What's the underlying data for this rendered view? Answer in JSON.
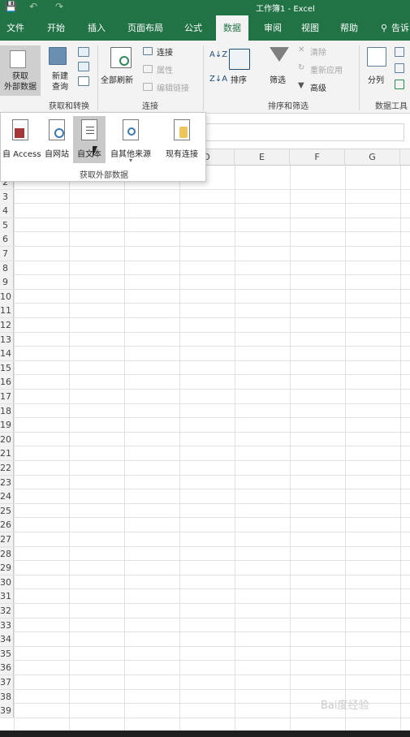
{
  "title_bar": {
    "title": "工作簿1  -  Excel",
    "save_icon": "save-icon",
    "undo_icon": "undo-icon",
    "redo_icon": "redo-icon"
  },
  "tabs": [
    {
      "label": "文件"
    },
    {
      "label": "开始"
    },
    {
      "label": "插入"
    },
    {
      "label": "页面布局"
    },
    {
      "label": "公式"
    },
    {
      "label": "数据",
      "active": true
    },
    {
      "label": "审阅"
    },
    {
      "label": "视图"
    },
    {
      "label": "帮助"
    },
    {
      "label": "告诉"
    }
  ],
  "ribbon": {
    "get_external": "获取\n外部数据",
    "new_query": "新建\n查询",
    "refresh_all": "全部刷新",
    "connections": "连接",
    "properties": "属性",
    "edit_links": "编辑链接",
    "sort": "排序",
    "filter": "筛选",
    "clear": "清除",
    "reapply": "重新应用",
    "advanced": "高级",
    "text_to_columns": "分列",
    "group_get_transform": "获取和转换",
    "group_connections": "连接",
    "group_sort_filter": "排序和筛选",
    "group_data_tools": "数据工具"
  },
  "dropdown": {
    "items": [
      {
        "label": "自 Access",
        "icon": "access-icon"
      },
      {
        "label": "自网站",
        "icon": "web-icon"
      },
      {
        "label": "自文本",
        "icon": "text-file-icon",
        "hover": true
      },
      {
        "label": "自其他来源",
        "icon": "other-sources-icon"
      },
      {
        "label": "现有连接",
        "icon": "existing-connections-icon"
      }
    ],
    "group_label": "获取外部数据"
  },
  "columns": [
    "D",
    "E",
    "F",
    "G"
  ],
  "rows": [
    "2",
    "3",
    "4",
    "5",
    "6",
    "7",
    "8",
    "9",
    "10",
    "11",
    "12",
    "13",
    "14",
    "15",
    "16",
    "17",
    "18",
    "19",
    "20",
    "21",
    "22",
    "23",
    "24",
    "25",
    "26",
    "27",
    "28",
    "29",
    "30",
    "31",
    "32",
    "33",
    "34",
    "35",
    "36",
    "37",
    "38",
    "39"
  ],
  "watermark": "Bai度经验",
  "colors": {
    "excel_green": "#217346",
    "ribbon_bg": "#f3f3f3"
  }
}
